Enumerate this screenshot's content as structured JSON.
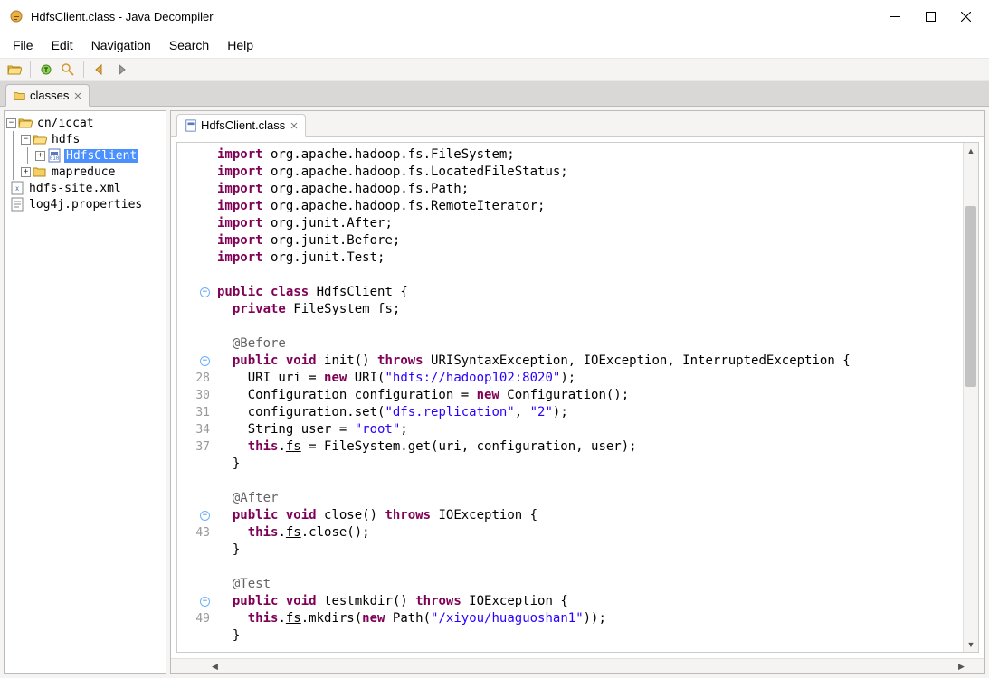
{
  "window": {
    "title": "HdfsClient.class - Java Decompiler"
  },
  "menu": {
    "file": "File",
    "edit": "Edit",
    "navigation": "Navigation",
    "search": "Search",
    "help": "Help"
  },
  "outerTab": {
    "label": "classes"
  },
  "tree": {
    "root": "cn/iccat",
    "hdfs": "hdfs",
    "hdfsclient": "HdfsClient",
    "mapreduce": "mapreduce",
    "sitexml": "hdfs-site.xml",
    "log4j": "log4j.properties"
  },
  "editorTab": {
    "label": "HdfsClient.class"
  },
  "gutter": {
    "l28": "28",
    "l30": "30",
    "l31": "31",
    "l34": "34",
    "l37": "37",
    "l43": "43",
    "l49": "49"
  },
  "code": {
    "imp1a": "import",
    "imp1b": " org.apache.hadoop.fs.FileSystem;",
    "imp2a": "import",
    "imp2b": " org.apache.hadoop.fs.LocatedFileStatus;",
    "imp3a": "import",
    "imp3b": " org.apache.hadoop.fs.Path;",
    "imp4a": "import",
    "imp4b": " org.apache.hadoop.fs.RemoteIterator;",
    "imp5a": "import",
    "imp5b": " org.junit.After;",
    "imp6a": "import",
    "imp6b": " org.junit.Before;",
    "imp7a": "import",
    "imp7b": " org.junit.Test;",
    "cls1": "public",
    "cls2": "class",
    "cls3": " HdfsClient {",
    "fld1": "private",
    "fld2": " FileSystem fs;",
    "ann_before": "@Before",
    "init1": "public",
    "init2": "void",
    "init3": " init() ",
    "init4": "throws",
    "init5": " URISyntaxException, IOException, InterruptedException {",
    "uri1": "    URI uri = ",
    "uri2": "new",
    "uri3": " URI(",
    "uri4": "\"hdfs://hadoop102:8020\"",
    "uri5": ");",
    "cfg1": "    Configuration configuration = ",
    "cfg2": "new",
    "cfg3": " Configuration();",
    "set1": "    configuration.set(",
    "set2": "\"dfs.replication\"",
    "set3": ", ",
    "set4": "\"2\"",
    "set5": ");",
    "usr1": "    String user = ",
    "usr2": "\"root\"",
    "usr3": ";",
    "get1": "this",
    "get2": ".",
    "get3": "fs",
    "get4": " = FileSystem.get(uri, configuration, user);",
    "brace_close": "  }",
    "ann_after": "@After",
    "close1": "public",
    "close2": "void",
    "close3": " close() ",
    "close4": "throws",
    "close5": " IOException {",
    "closeb1": "this",
    "closeb2": ".",
    "closeb3": "fs",
    "closeb4": ".close();",
    "ann_test": "@Test",
    "mk1": "public",
    "mk2": "void",
    "mk3": " testmkdir() ",
    "mk4": "throws",
    "mk5": " IOException {",
    "mkb1": "this",
    "mkb2": ".",
    "mkb3": "fs",
    "mkb4": ".mkdirs(",
    "mkb5": "new",
    "mkb6": " Path(",
    "mkb7": "\"/xiyou/huaguoshan1\"",
    "mkb8": "));"
  }
}
